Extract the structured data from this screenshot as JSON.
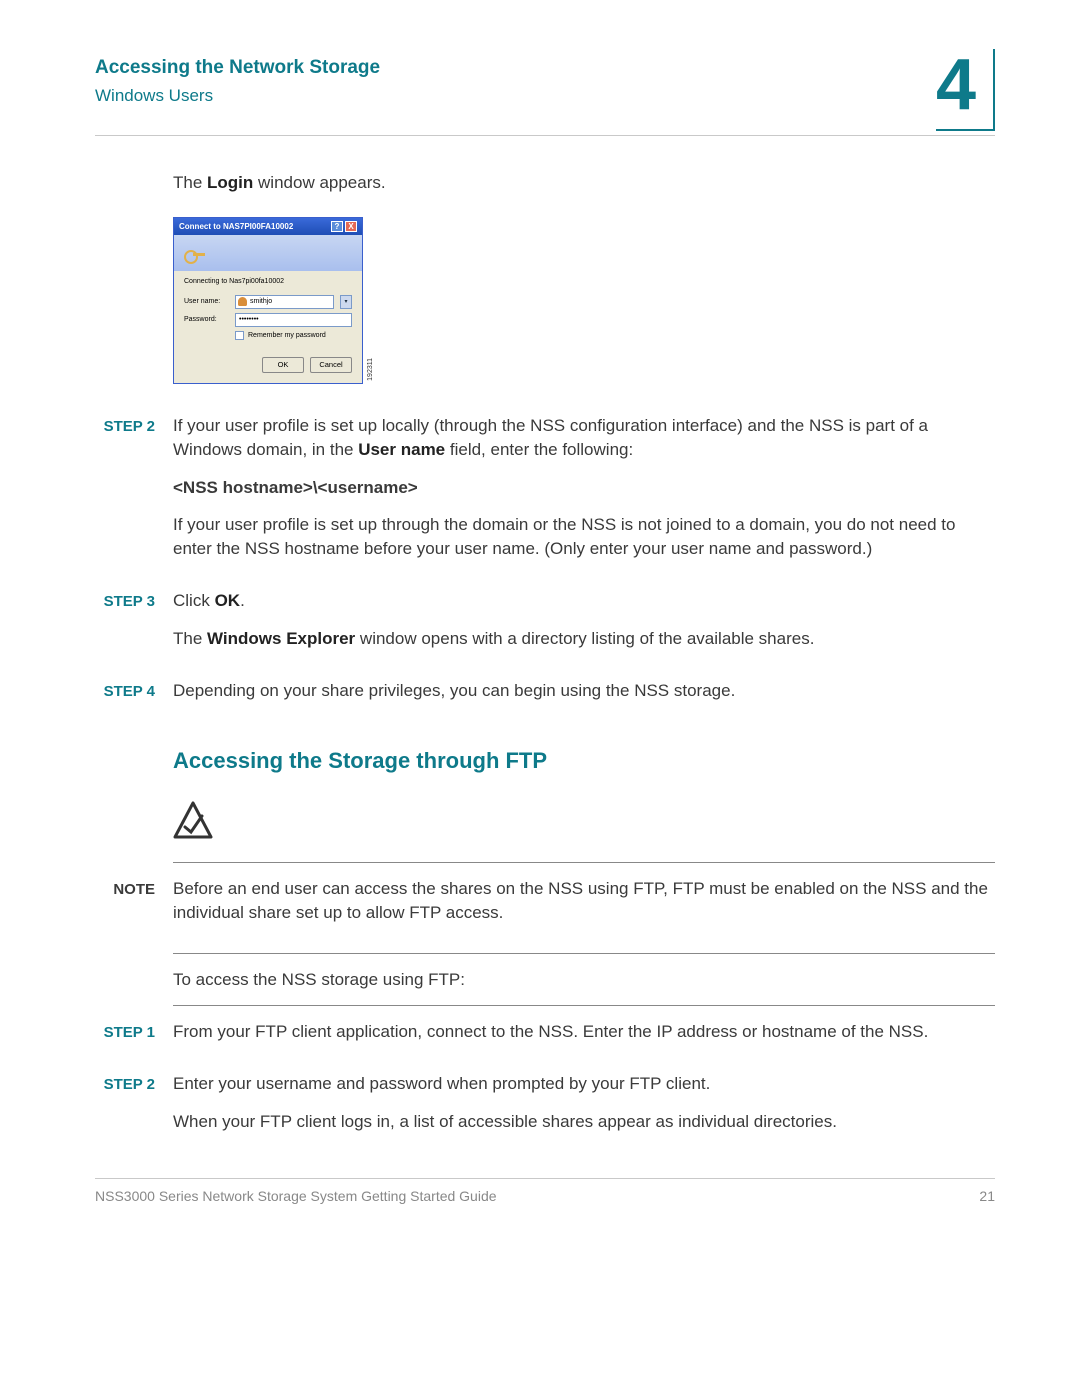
{
  "header": {
    "title": "Accessing the Network Storage",
    "subtitle": "Windows Users",
    "chapter": "4"
  },
  "intro_pre": "The ",
  "intro_bold": "Login",
  "intro_post": " window appears.",
  "dialog": {
    "title": "Connect to NAS7PI00FA10002",
    "connecting": "Connecting to Nas7pi00fa10002",
    "user_label": "User name:",
    "user_value": "smithjo",
    "pass_label": "Password:",
    "pass_value": "••••••••",
    "remember": "Remember my password",
    "ok": "OK",
    "cancel": "Cancel",
    "sidecode": "192311"
  },
  "step2": {
    "label": "STEP 2",
    "p1a": "If your user profile is set up locally (through the NSS configuration interface) and the NSS is part of a Windows domain, in the ",
    "p1b": "User name",
    "p1c": " field, enter the following:",
    "format": "<NSS hostname>\\<username>",
    "p2": "If your user profile is set up through the domain or the NSS is not joined to a domain, you do not need to enter the NSS hostname before your user name. (Only enter your user name and password.)"
  },
  "step3": {
    "label": "STEP 3",
    "p1a": "Click ",
    "p1b": "OK",
    "p1c": ".",
    "p2a": "The ",
    "p2b": "Windows Explorer",
    "p2c": " window opens with a directory listing of the available shares."
  },
  "step4": {
    "label": "STEP 4",
    "p1": "Depending on your share privileges, you can begin using the NSS storage."
  },
  "sectionTitle": "Accessing the Storage through FTP",
  "note": {
    "label": "NOTE",
    "text": "Before an end user can access the shares on the NSS using FTP, FTP must be enabled on the NSS and the individual share set up to allow FTP access."
  },
  "ftp_intro": "To access the NSS storage using FTP:",
  "fstep1": {
    "label": "STEP 1",
    "text": "From your FTP client application, connect to the NSS. Enter the IP address or hostname of the NSS."
  },
  "fstep2": {
    "label": "STEP 2",
    "p1": "Enter your username and password when prompted by your FTP client.",
    "p2": "When your FTP client logs in, a list of accessible shares appear as individual directories."
  },
  "footer": {
    "left": "NSS3000 Series Network Storage System Getting Started Guide",
    "right": "21"
  }
}
